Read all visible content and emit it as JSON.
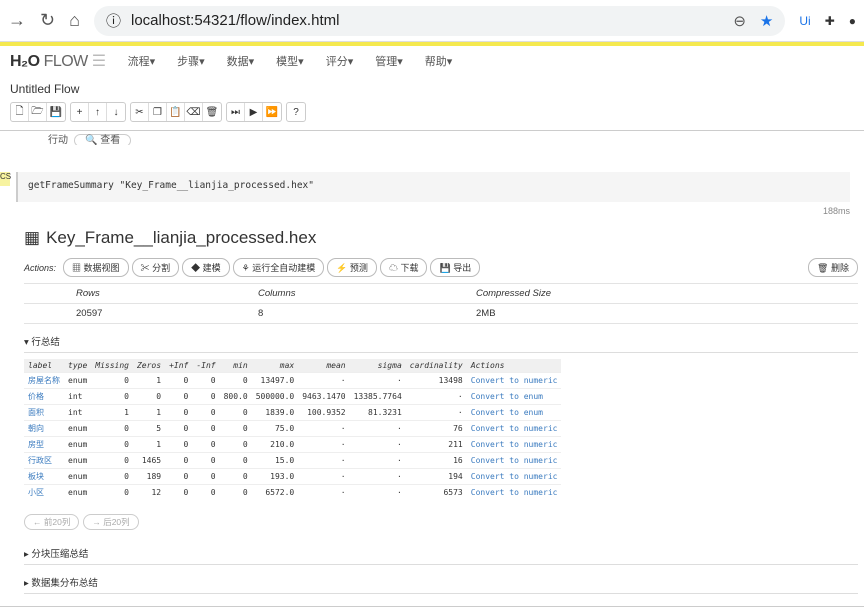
{
  "browser": {
    "url": "localhost:54321/flow/index.html"
  },
  "app": {
    "logo_main": "H₂O",
    "logo_sub": "FLOW",
    "menus": [
      "流程▾",
      "步骤▾",
      "数据▾",
      "模型▾",
      "评分▾",
      "管理▾",
      "帮助▾"
    ],
    "flow_title": "Untitled Flow"
  },
  "prev_cell": {
    "label": "行动",
    "button": "查看"
  },
  "cell": {
    "marker": "CS",
    "code": "getFrameSummary \"Key_Frame__lianjia_processed.hex\"",
    "time": "188ms"
  },
  "frame": {
    "title": "Key_Frame__lianjia_processed.hex",
    "actions_label": "Actions:",
    "buttons": [
      "数据视图",
      "分割",
      "建模",
      "运行全自动建模",
      "预测",
      "下载",
      "导出"
    ],
    "delete": "删除",
    "stats_headers": [
      "Rows",
      "Columns",
      "Compressed Size"
    ],
    "stats_values": [
      "20597",
      "8",
      "2MB"
    ],
    "sections": [
      "行总结",
      "分块压缩总结",
      "数据集分布总结"
    ],
    "columns": [
      "label",
      "type",
      "Missing",
      "Zeros",
      "+Inf",
      "-Inf",
      "min",
      "max",
      "mean",
      "sigma",
      "cardinality",
      "Actions"
    ],
    "rows": [
      [
        "房屋名称",
        "enum",
        "0",
        "1",
        "0",
        "0",
        "0",
        "13497.0",
        "·",
        "·",
        "13498",
        "Convert to numeric"
      ],
      [
        "价格",
        "int",
        "0",
        "0",
        "0",
        "0",
        "800.0",
        "500000.0",
        "9463.1470",
        "13385.7764",
        "·",
        "Convert to enum"
      ],
      [
        "面积",
        "int",
        "1",
        "1",
        "0",
        "0",
        "0",
        "1839.0",
        "100.9352",
        "81.3231",
        "·",
        "Convert to enum"
      ],
      [
        "朝向",
        "enum",
        "0",
        "5",
        "0",
        "0",
        "0",
        "75.0",
        "·",
        "·",
        "76",
        "Convert to numeric"
      ],
      [
        "房型",
        "enum",
        "0",
        "1",
        "0",
        "0",
        "0",
        "210.0",
        "·",
        "·",
        "211",
        "Convert to numeric"
      ],
      [
        "行政区",
        "enum",
        "0",
        "1465",
        "0",
        "0",
        "0",
        "15.0",
        "·",
        "·",
        "16",
        "Convert to numeric"
      ],
      [
        "板块",
        "enum",
        "0",
        "189",
        "0",
        "0",
        "0",
        "193.0",
        "·",
        "·",
        "194",
        "Convert to numeric"
      ],
      [
        "小区",
        "enum",
        "0",
        "12",
        "0",
        "0",
        "0",
        "6572.0",
        "·",
        "·",
        "6573",
        "Convert to numeric"
      ]
    ],
    "pager": [
      "← 前20列",
      "→ 后20列"
    ]
  }
}
